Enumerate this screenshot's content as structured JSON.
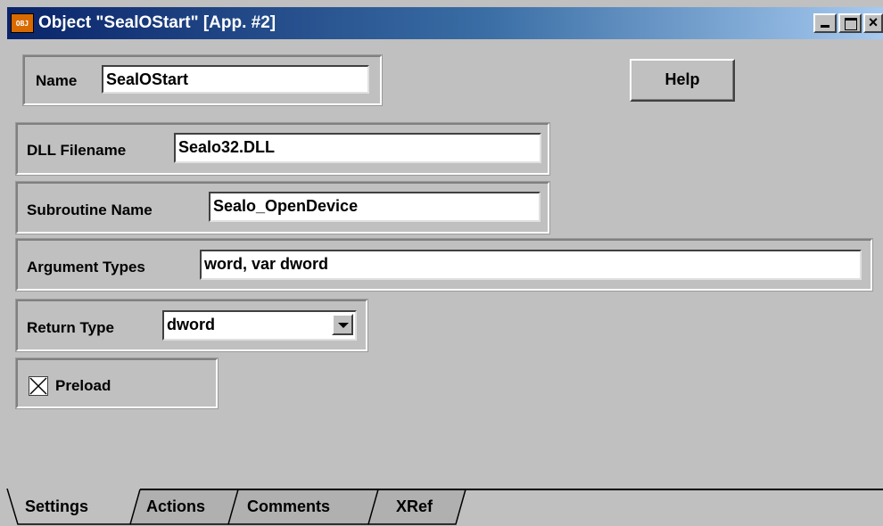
{
  "window": {
    "title": "Object \"SealOStart\" [App. #2]",
    "icon_text": "OBJ"
  },
  "form": {
    "name_label": "Name",
    "name_value": "SealOStart",
    "help_label": "Help",
    "dll_label": "DLL Filename",
    "dll_value": "Sealo32.DLL",
    "sub_label": "Subroutine Name",
    "sub_value": "Sealo_OpenDevice",
    "args_label": "Argument Types",
    "args_value": "word, var dword",
    "return_label": "Return Type",
    "return_value": "dword",
    "preload_label": "Preload",
    "preload_checked": true
  },
  "tabs": [
    {
      "label": "Settings",
      "active": true
    },
    {
      "label": "Actions",
      "active": false
    },
    {
      "label": "Comments",
      "active": false
    },
    {
      "label": "XRef",
      "active": false
    }
  ]
}
